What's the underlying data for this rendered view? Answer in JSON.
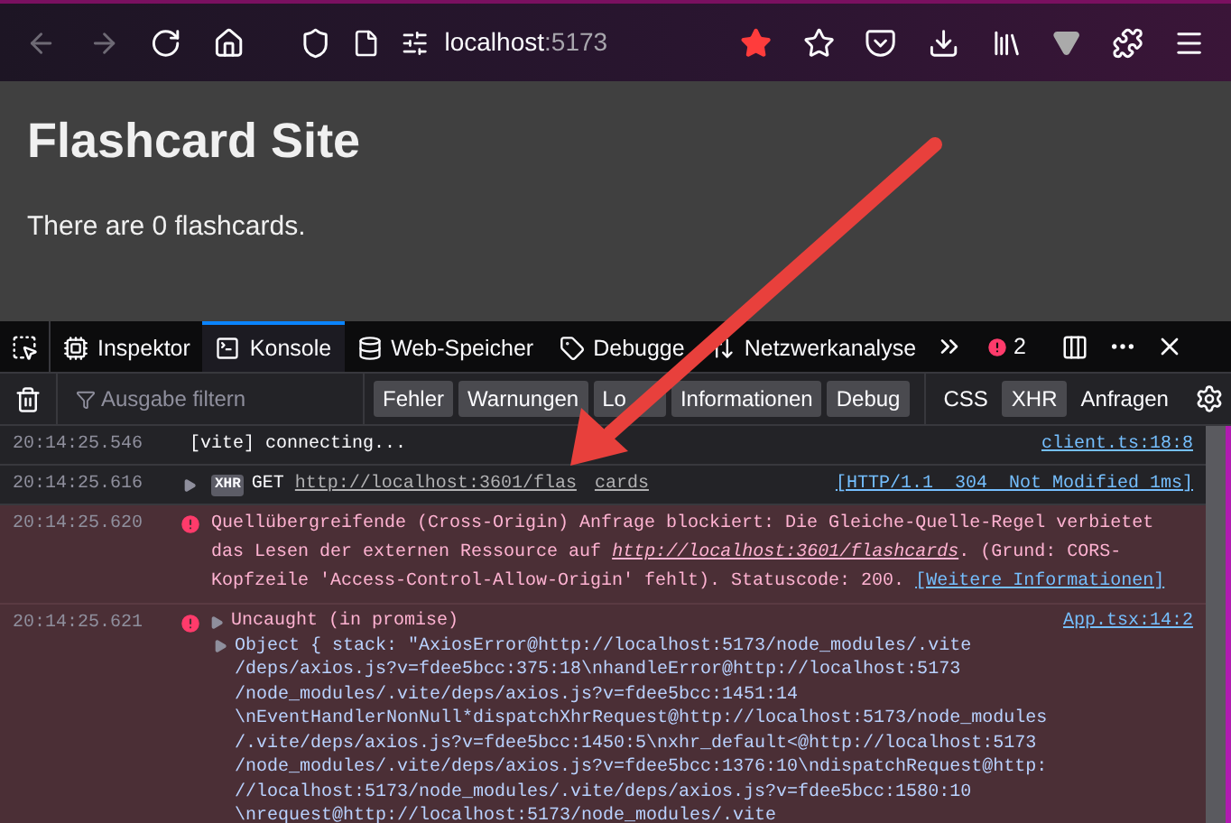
{
  "browser": {
    "url_host": "localhost",
    "url_port": ":5173",
    "bookmarked": true
  },
  "page": {
    "heading": "Flashcard Site",
    "text": "There are 0 flashcards."
  },
  "devtools": {
    "tabs": [
      {
        "label": "Inspektor",
        "selected": false
      },
      {
        "label": "Konsole",
        "selected": true
      },
      {
        "label": "Web-Speicher",
        "selected": false
      },
      {
        "label": "Debugge",
        "selected": false
      },
      {
        "label": "Netzwerkanalyse",
        "selected": false
      }
    ],
    "error_count": "2",
    "filter_placeholder": "Ausgabe filtern",
    "filters": [
      {
        "label": "Fehler",
        "selected": true
      },
      {
        "label": "Warnungen",
        "selected": true
      },
      {
        "label": "Lo",
        "selected": true
      },
      {
        "label": "Informationen",
        "selected": true
      },
      {
        "label": "Debug",
        "selected": true
      }
    ],
    "extra_filters": [
      {
        "label": "CSS",
        "selected": false
      },
      {
        "label": "XHR",
        "selected": true
      },
      {
        "label": "Anfragen",
        "selected": false
      }
    ],
    "messages": [
      {
        "kind": "log",
        "time": "20:14:25.546",
        "text": "[vite] connecting...",
        "source": "client.ts:18:8"
      },
      {
        "kind": "xhr",
        "time": "20:14:25.616",
        "badge": "XHR",
        "method": "GET",
        "url": "http://localhost:3601/flas",
        "url_end": "cards",
        "source": "[HTTP/1.1  304  Not Modified 1ms]"
      },
      {
        "kind": "error",
        "time": "20:14:25.620",
        "text_before": "Quellübergreifende (Cross-Origin) Anfrage blockiert: Die Gleiche-Quelle-Regel verbietet das Lesen der externen Ressource auf",
        "link": "http://localhost:3601/flashcards",
        "text_after": ". (Grund: CORS-Kopfzeile 'Access-Control-Allow-Origin' fehlt). Statuscode: 200.",
        "more": "[Weitere Informationen]"
      },
      {
        "kind": "uncaught",
        "time": "20:14:25.621",
        "text": "Uncaught (in promise)",
        "source": "App.tsx:14:2",
        "object_head": "Object { stack: \"AxiosError@http://localhost:5173/node_modules/.vite",
        "lines": [
          "/deps/axios.js?v=fdee5bcc:375:18\\nhandleError@http://localhost:5173",
          "/node_modules/.vite/deps/axios.js?v=fdee5bcc:1451:14",
          "\\nEventHandlerNonNull*dispatchXhrRequest@http://localhost:5173/node_modules",
          "/.vite/deps/axios.js?v=fdee5bcc:1450:5\\nxhr_default<@http://localhost:5173",
          "/node_modules/.vite/deps/axios.js?v=fdee5bcc:1376:10\\ndispatchRequest@http:",
          "//localhost:5173/node_modules/.vite/deps/axios.js?v=fdee5bcc:1580:10",
          "\\nrequest@http://localhost:5173/node_modules/.vite"
        ]
      }
    ]
  }
}
